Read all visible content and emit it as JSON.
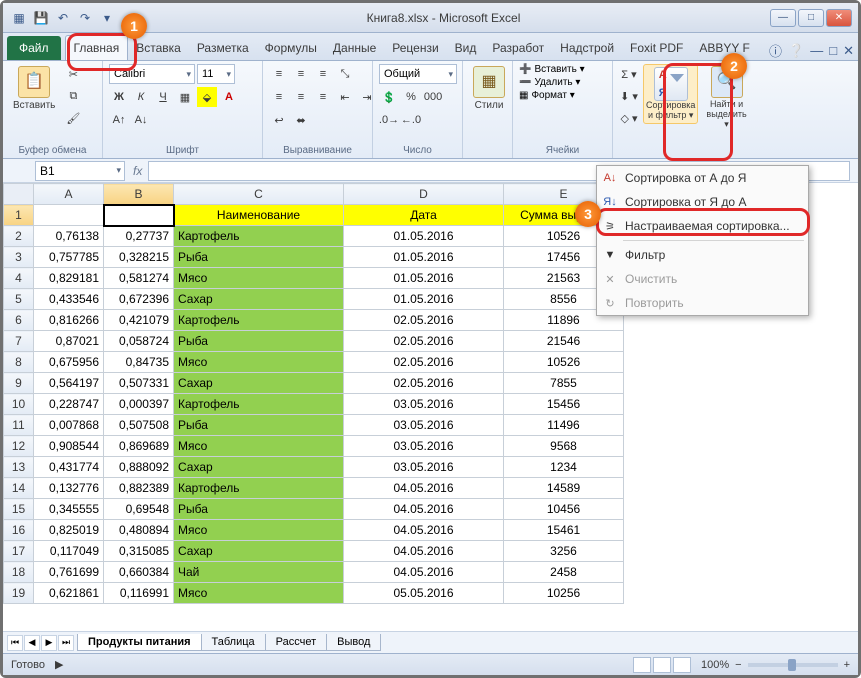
{
  "title": "Книга8.xlsx - Microsoft Excel",
  "file_tab": "Файл",
  "tabs": [
    "Главная",
    "Вставка",
    "Разметка",
    "Формулы",
    "Данные",
    "Рецензи",
    "Вид",
    "Разработ",
    "Надстрой",
    "Foxit PDF",
    "ABBYY F"
  ],
  "groups": {
    "clipboard": {
      "label": "Буфер обмена",
      "paste": "Вставить"
    },
    "font": {
      "label": "Шрифт",
      "name": "Calibri",
      "size": "11"
    },
    "align": {
      "label": "Выравнивание"
    },
    "number": {
      "label": "Число",
      "format": "Общий"
    },
    "styles": {
      "label": "",
      "btn": "Стили"
    },
    "cells": {
      "label": "Ячейки",
      "insert": "Вставить ▾",
      "delete": "Удалить ▾",
      "format": "Формат ▾"
    },
    "editing": {
      "sort": "Сортировка и фильтр ▾",
      "find": "Найти и выделить ▾"
    }
  },
  "namebox": "B1",
  "columns": [
    "A",
    "B",
    "C",
    "D",
    "E"
  ],
  "headers": {
    "c": "Наименование",
    "d": "Дата",
    "e": "Сумма выручки"
  },
  "rows": [
    {
      "n": 1
    },
    {
      "n": 2,
      "a": "0,76138",
      "b": "0,27737",
      "c": "Картофель",
      "d": "01.05.2016",
      "e": "10526"
    },
    {
      "n": 3,
      "a": "0,757785",
      "b": "0,328215",
      "c": "Рыба",
      "d": "01.05.2016",
      "e": "17456"
    },
    {
      "n": 4,
      "a": "0,829181",
      "b": "0,581274",
      "c": "Мясо",
      "d": "01.05.2016",
      "e": "21563"
    },
    {
      "n": 5,
      "a": "0,433546",
      "b": "0,672396",
      "c": "Сахар",
      "d": "01.05.2016",
      "e": "8556"
    },
    {
      "n": 6,
      "a": "0,816266",
      "b": "0,421079",
      "c": "Картофель",
      "d": "02.05.2016",
      "e": "11896"
    },
    {
      "n": 7,
      "a": "0,87021",
      "b": "0,058724",
      "c": "Рыба",
      "d": "02.05.2016",
      "e": "21546"
    },
    {
      "n": 8,
      "a": "0,675956",
      "b": "0,84735",
      "c": "Мясо",
      "d": "02.05.2016",
      "e": "10526"
    },
    {
      "n": 9,
      "a": "0,564197",
      "b": "0,507331",
      "c": "Сахар",
      "d": "02.05.2016",
      "e": "7855"
    },
    {
      "n": 10,
      "a": "0,228747",
      "b": "0,000397",
      "c": "Картофель",
      "d": "03.05.2016",
      "e": "15456"
    },
    {
      "n": 11,
      "a": "0,007868",
      "b": "0,507508",
      "c": "Рыба",
      "d": "03.05.2016",
      "e": "11496"
    },
    {
      "n": 12,
      "a": "0,908544",
      "b": "0,869689",
      "c": "Мясо",
      "d": "03.05.2016",
      "e": "9568"
    },
    {
      "n": 13,
      "a": "0,431774",
      "b": "0,888092",
      "c": "Сахар",
      "d": "03.05.2016",
      "e": "1234"
    },
    {
      "n": 14,
      "a": "0,132776",
      "b": "0,882389",
      "c": "Картофель",
      "d": "04.05.2016",
      "e": "14589"
    },
    {
      "n": 15,
      "a": "0,345555",
      "b": "0,69548",
      "c": "Рыба",
      "d": "04.05.2016",
      "e": "10456"
    },
    {
      "n": 16,
      "a": "0,825019",
      "b": "0,480894",
      "c": "Мясо",
      "d": "04.05.2016",
      "e": "15461"
    },
    {
      "n": 17,
      "a": "0,117049",
      "b": "0,315085",
      "c": "Сахар",
      "d": "04.05.2016",
      "e": "3256"
    },
    {
      "n": 18,
      "a": "0,761699",
      "b": "0,660384",
      "c": "Чай",
      "d": "04.05.2016",
      "e": "2458"
    },
    {
      "n": 19,
      "a": "0,621861",
      "b": "0,116991",
      "c": "Мясо",
      "d": "05.05.2016",
      "e": "10256"
    }
  ],
  "sheet_tabs": [
    "Продукты питания",
    "Таблица",
    "Рассчет",
    "Вывод"
  ],
  "status": "Готово",
  "zoom": "100%",
  "dropdown": {
    "sort_az": "Сортировка от А до Я",
    "sort_za": "Сортировка от Я до А",
    "custom": "Настраиваемая сортировка...",
    "filter": "Фильтр",
    "clear": "Очистить",
    "reapply": "Повторить"
  },
  "badges": {
    "b1": "1",
    "b2": "2",
    "b3": "3"
  }
}
